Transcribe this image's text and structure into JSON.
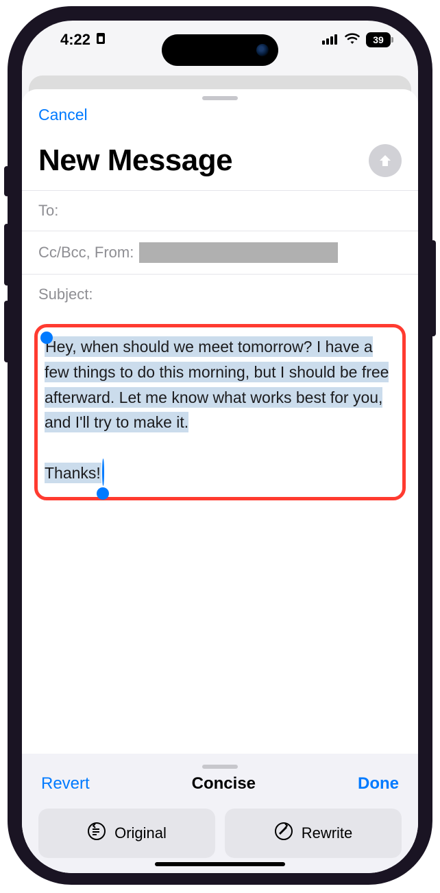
{
  "status": {
    "time": "4:22",
    "battery": "39"
  },
  "compose": {
    "cancel": "Cancel",
    "title": "New Message",
    "to_label": "To:",
    "cc_label": "Cc/Bcc, From:",
    "subject_label": "Subject:",
    "body_line1": "Hey, when should we meet tomorrow? I have a few things to do this morning, but I should be free afterward. Let me know what works best for you, and I'll try to make it.",
    "body_line2": "Thanks!"
  },
  "toolbar": {
    "revert": "Revert",
    "mode": "Concise",
    "done": "Done",
    "original": "Original",
    "rewrite": "Rewrite"
  }
}
